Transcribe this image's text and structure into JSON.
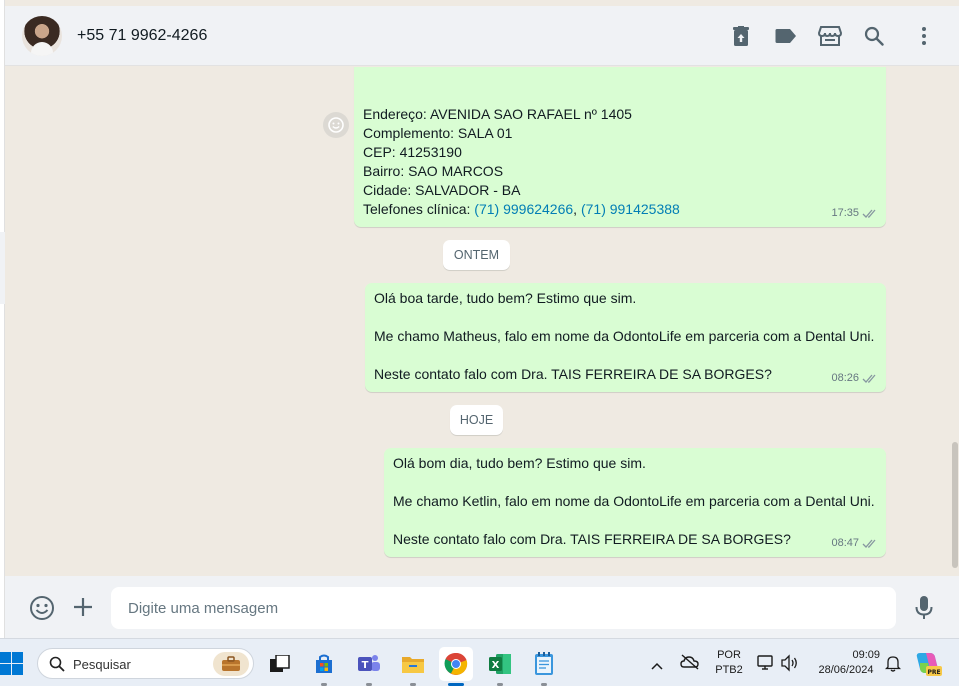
{
  "header": {
    "contact_name": "+55 71 9962-4266",
    "avatar_icon": "contact-avatar",
    "actions": [
      "archive-icon",
      "label-icon",
      "catalog-store-icon",
      "search-icon",
      "menu-icon"
    ]
  },
  "messages": {
    "address": {
      "lines": [
        "Endereço: AVENIDA SAO RAFAEL nº 1405",
        "Complemento: SALA 01",
        "CEP: 41253190",
        "Bairro: SAO MARCOS",
        "Cidade: SALVADOR - BA"
      ],
      "phones_label": "Telefones clínica: ",
      "phone_1": "(71) 999624266",
      "phone_sep": ", ",
      "phone_2": "(71) 991425388",
      "time": "17:35"
    },
    "chip_yesterday": "ONTEM",
    "msg_yesterday": {
      "line1": "Olá boa tarde, tudo bem? Estimo que sim.",
      "line2": "Me chamo Matheus, falo em nome da OdontoLife em parceria com a Dental Uni.",
      "line3": "Neste contato falo com Dra. TAIS FERREIRA DE SA BORGES?",
      "time": "08:26"
    },
    "chip_today": "HOJE",
    "msg_today": {
      "line1": "Olá bom dia, tudo bem? Estimo que sim.",
      "line2": "Me chamo Ketlin, falo em nome da OdontoLife em parceria com a Dental Uni.",
      "line3": "Neste contato falo com Dra. TAIS FERREIRA DE SA BORGES?",
      "time": "08:47"
    }
  },
  "compose": {
    "placeholder": "Digite uma mensagem"
  },
  "taskbar": {
    "search_label": "Pesquisar",
    "lang_line1": "POR",
    "lang_line2": "PTB2",
    "time": "09:09",
    "date": "28/06/2024",
    "apps": [
      "task-view",
      "microsoft-store",
      "teams",
      "file-explorer",
      "chrome",
      "excel",
      "notepad"
    ]
  },
  "colors": {
    "accent_bubble": "#d9fdd3",
    "link": "#027eb5",
    "chat_bg": "#efeae2"
  }
}
